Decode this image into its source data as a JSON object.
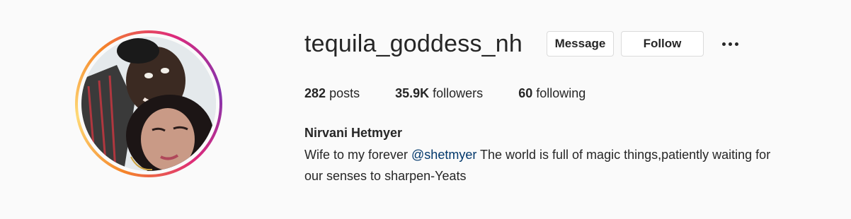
{
  "profile": {
    "username": "tequila_goddess_nh",
    "buttons": {
      "message": "Message",
      "follow": "Follow"
    },
    "stats": {
      "posts_count": "282",
      "posts_label": "posts",
      "followers_count": "35.9K",
      "followers_label": "followers",
      "following_count": "60",
      "following_label": "following"
    },
    "full_name": "Nirvani Hetmyer",
    "bio": {
      "prefix": "Wife to my forever ",
      "mention": "@shetmyer",
      "suffix_line1": " The world is full of magic things,patiently waiting for",
      "line2": "our senses to sharpen-Yeats"
    },
    "avatar_ring_colors": [
      "#f58529",
      "#feda77",
      "#dd2a7b",
      "#8134af"
    ],
    "icons": {
      "more": "more-horizontal-icon",
      "avatar": "profile-picture"
    }
  }
}
